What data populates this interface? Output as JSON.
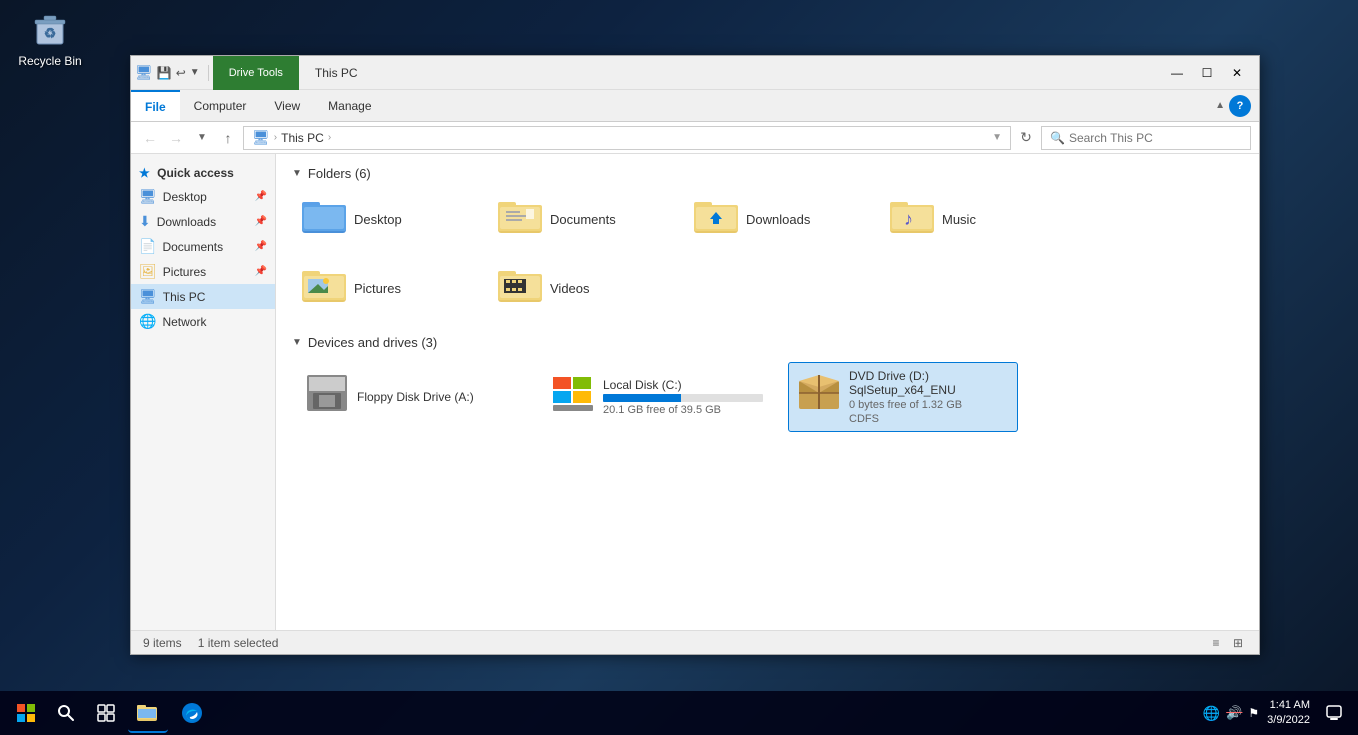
{
  "desktop": {
    "recycle_bin_label": "Recycle Bin"
  },
  "explorer": {
    "window_title": "This PC",
    "drive_tools_tab": "Drive Tools",
    "ribbon_tabs": [
      {
        "id": "file",
        "label": "File",
        "active": false
      },
      {
        "id": "computer",
        "label": "Computer",
        "active": false
      },
      {
        "id": "view",
        "label": "View",
        "active": false
      },
      {
        "id": "manage",
        "label": "Manage",
        "active": true
      }
    ],
    "address_bar": {
      "path_segments": [
        "This PC"
      ],
      "search_placeholder": "Search This PC"
    },
    "sidebar": {
      "quick_access_label": "Quick access",
      "items": [
        {
          "id": "desktop",
          "label": "Desktop",
          "pinned": true
        },
        {
          "id": "downloads",
          "label": "Downloads",
          "pinned": true
        },
        {
          "id": "documents",
          "label": "Documents",
          "pinned": true
        },
        {
          "id": "pictures",
          "label": "Pictures",
          "pinned": true
        }
      ],
      "this_pc_label": "This PC",
      "network_label": "Network"
    },
    "folders_section": {
      "header": "Folders (6)",
      "items": [
        {
          "id": "desktop",
          "label": "Desktop"
        },
        {
          "id": "documents",
          "label": "Documents"
        },
        {
          "id": "downloads",
          "label": "Downloads"
        },
        {
          "id": "music",
          "label": "Music"
        },
        {
          "id": "pictures",
          "label": "Pictures"
        },
        {
          "id": "videos",
          "label": "Videos"
        }
      ]
    },
    "devices_section": {
      "header": "Devices and drives (3)",
      "items": [
        {
          "id": "floppy",
          "label": "Floppy Disk Drive (A:)",
          "has_bar": false,
          "selected": false
        },
        {
          "id": "local_disk",
          "label": "Local Disk (C:)",
          "has_bar": true,
          "free_space": "20.1 GB free of 39.5 GB",
          "fill_percent": 49,
          "critical": false,
          "selected": false
        },
        {
          "id": "dvd",
          "label": "DVD Drive (D:) SqlSetup_x64_ENU",
          "has_bar": false,
          "sub_label": "0 bytes free of 1.32 GB",
          "fs_label": "CDFS",
          "selected": true
        }
      ]
    },
    "status_bar": {
      "items_count": "9 items",
      "selected_count": "1 item selected"
    }
  },
  "taskbar": {
    "clock_time": "1:41 AM",
    "clock_date": "3/9/2022",
    "start_icon": "⊞",
    "search_icon": "🔍",
    "task_view_icon": "⧉"
  }
}
